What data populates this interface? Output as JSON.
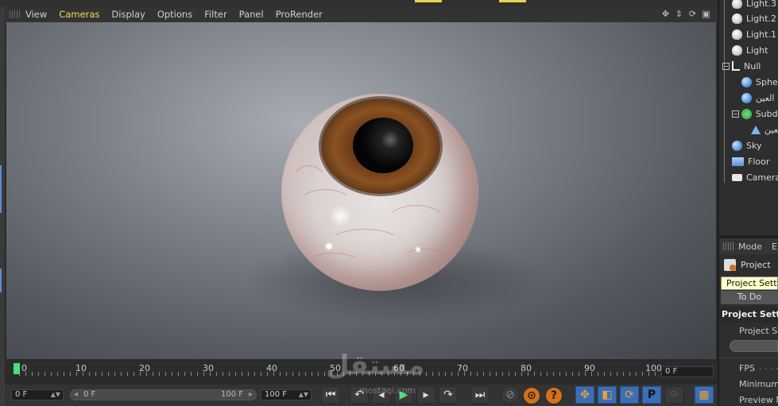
{
  "viewport_menu": {
    "items": [
      "View",
      "Cameras",
      "Display",
      "Options",
      "Filter",
      "Panel",
      "ProRender"
    ],
    "active": "Cameras"
  },
  "timeline": {
    "ticks": [
      "0",
      "10",
      "20",
      "30",
      "40",
      "50",
      "60",
      "70",
      "80",
      "90",
      "100"
    ],
    "current_frame": "0 F"
  },
  "bottom_bar": {
    "start_field": "0 F",
    "slider_left": "0 F",
    "slider_right": "100 F",
    "end_field": "100 F"
  },
  "object_manager": {
    "objects": [
      "Light.3",
      "Light.2",
      "Light.1",
      "Light",
      "Null",
      "Sphere",
      "العين",
      "Subdivision",
      "العين",
      "Sky",
      "Floor",
      "Camera"
    ]
  },
  "attribute_manager": {
    "mode_label": "Mode",
    "edit_label": "E",
    "project_label": "Project",
    "tooltip": "Project Settings",
    "todo_label": "To Do",
    "section_title": "Project Settings",
    "fields": [
      "Project Scale",
      "FPS",
      "Minimum",
      "Preview M"
    ]
  },
  "watermark": {
    "logo": "مستقل",
    "url": "mostaql.com"
  }
}
